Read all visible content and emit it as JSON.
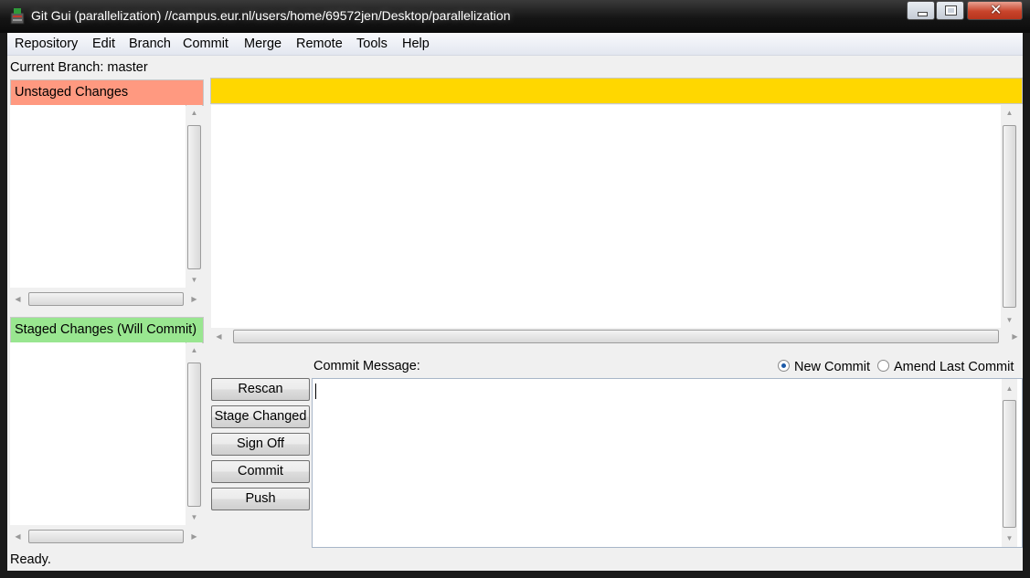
{
  "window": {
    "title": "Git Gui (parallelization) //campus.eur.nl/users/home/69572jen/Desktop/parallelization",
    "controls": {
      "minimize": "",
      "maximize": "",
      "close": "✕"
    }
  },
  "menu": [
    "Repository",
    "Edit",
    "Branch",
    "Commit",
    "Merge",
    "Remote",
    "Tools",
    "Help"
  ],
  "branch": {
    "label": "Current Branch: master"
  },
  "unstaged": {
    "title": "Unstaged Changes",
    "color": "#ff9980"
  },
  "staged": {
    "title": "Staged Changes (Will Commit)",
    "color": "#99e690"
  },
  "diff": {
    "header_color": "#ffd700"
  },
  "commit": {
    "label": "Commit Message:",
    "options": [
      {
        "label": "New Commit",
        "selected": true
      },
      {
        "label": "Amend Last Commit",
        "selected": false
      }
    ],
    "message": ""
  },
  "buttons": {
    "rescan": "Rescan",
    "stage_changed": "Stage Changed",
    "sign_off": "Sign Off",
    "commit": "Commit",
    "push": "Push"
  },
  "status": "Ready."
}
